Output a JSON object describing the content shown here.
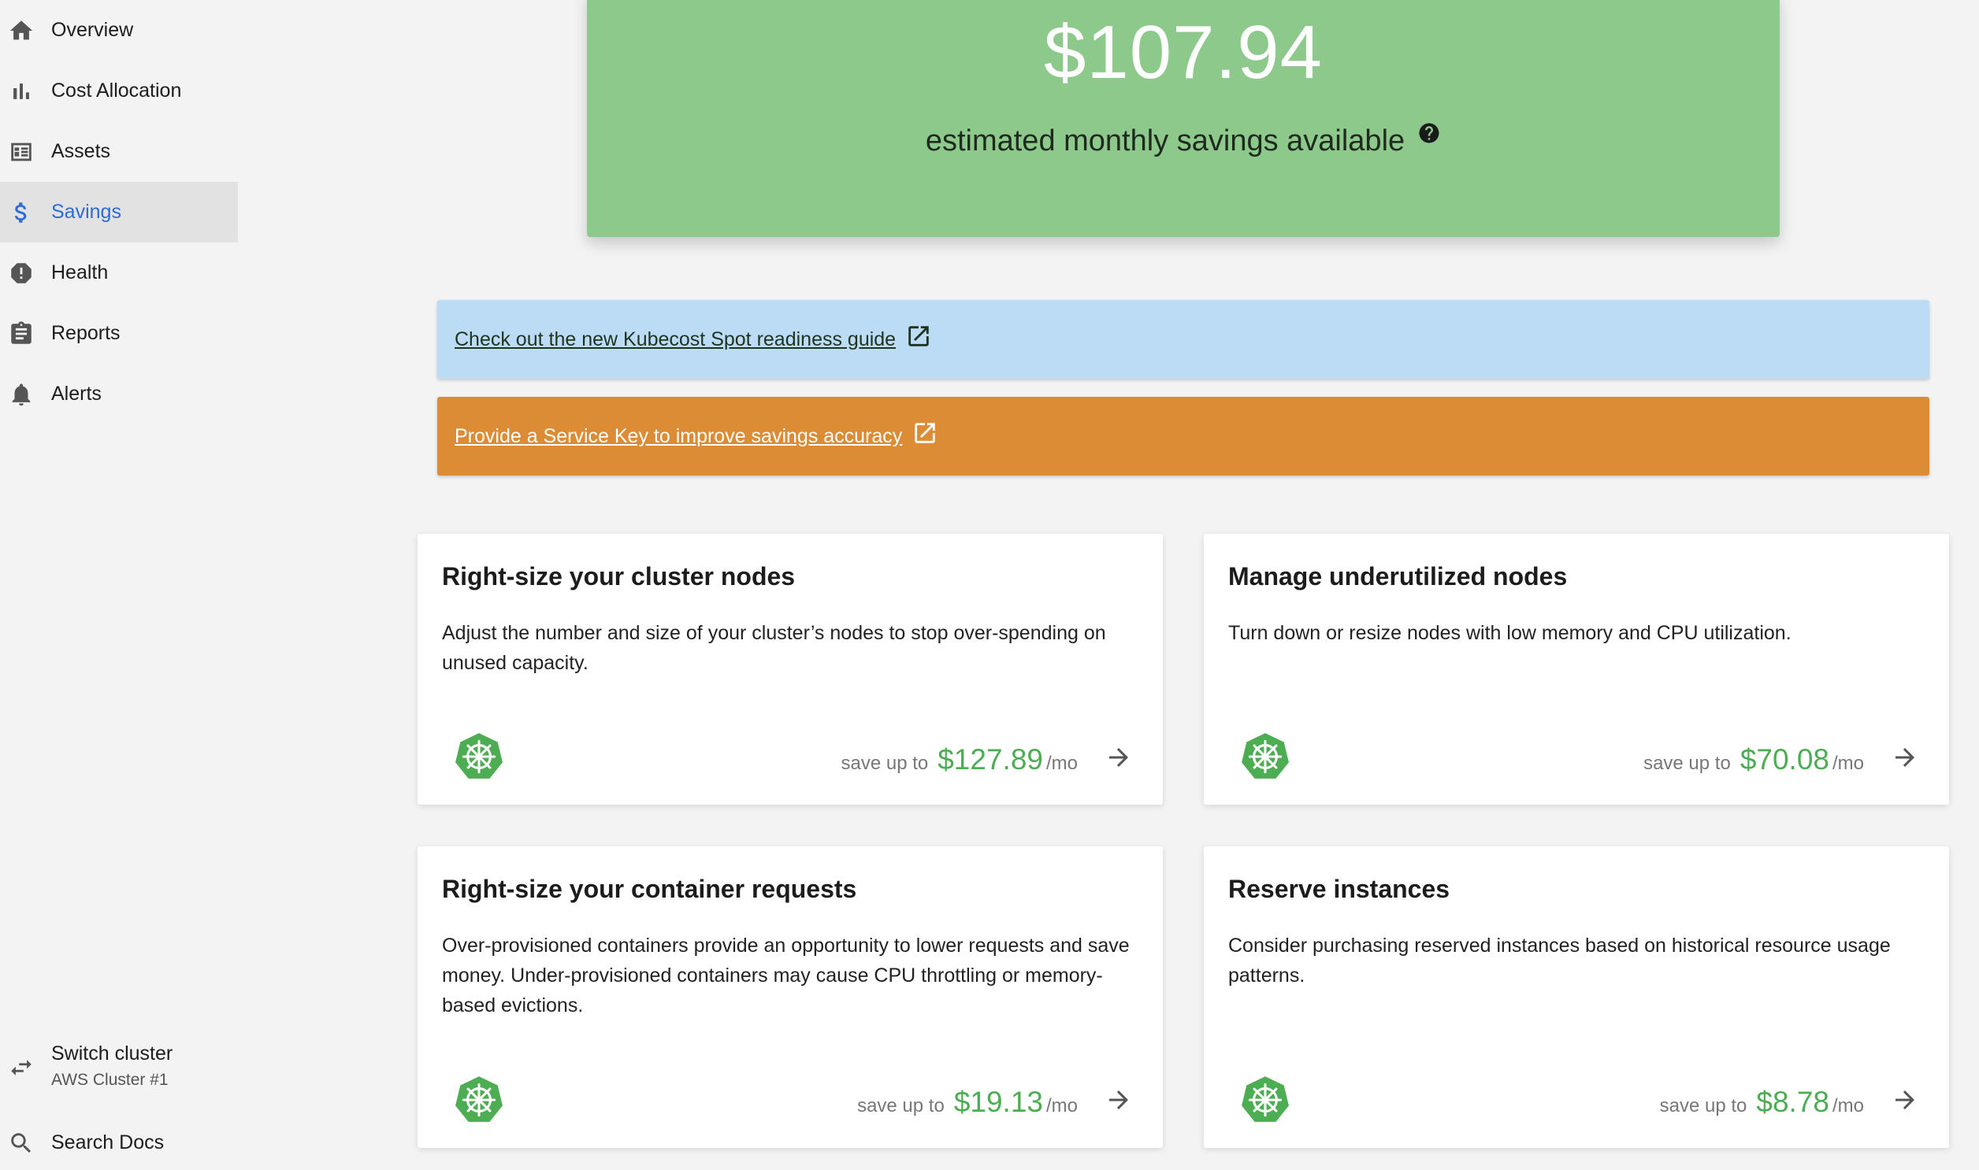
{
  "sidebar": {
    "items": [
      {
        "label": "Overview",
        "icon": "home-icon"
      },
      {
        "label": "Cost Allocation",
        "icon": "bar-chart-icon"
      },
      {
        "label": "Assets",
        "icon": "assets-icon"
      },
      {
        "label": "Savings",
        "icon": "dollar-icon",
        "active": true
      },
      {
        "label": "Health",
        "icon": "alert-octagon-icon"
      },
      {
        "label": "Reports",
        "icon": "clipboard-icon"
      },
      {
        "label": "Alerts",
        "icon": "bell-icon"
      }
    ],
    "switch_cluster": {
      "label": "Switch cluster",
      "sub": "AWS Cluster #1",
      "icon": "swap-arrows-icon"
    },
    "search_docs": {
      "label": "Search Docs",
      "icon": "search-icon"
    }
  },
  "hero": {
    "amount": "$107.94",
    "subtitle": "estimated monthly savings available",
    "color": "#8cc98a"
  },
  "banners": {
    "spot_guide": "Check out the new Kubecost Spot readiness guide",
    "service_key": "Provide a Service Key to improve savings accuracy"
  },
  "cards": [
    {
      "title": "Right-size your cluster nodes",
      "description": "Adjust the number and size of your cluster’s nodes to stop over-spending on unused capacity.",
      "save_label": "save up to",
      "amount": "$127.89",
      "unit": "/mo"
    },
    {
      "title": "Manage underutilized nodes",
      "description": "Turn down or resize nodes with low memory and CPU utilization.",
      "save_label": "save up to",
      "amount": "$70.08",
      "unit": "/mo"
    },
    {
      "title": "Right-size your container requests",
      "description": "Over-provisioned containers provide an opportunity to lower requests and save money. Under-provisioned containers may cause CPU throttling or memory-based evictions.",
      "save_label": "save up to",
      "amount": "$19.13",
      "unit": "/mo"
    },
    {
      "title": "Reserve instances",
      "description": "Consider purchasing reserved instances based on historical resource usage patterns.",
      "save_label": "save up to",
      "amount": "$8.78",
      "unit": "/mo"
    }
  ],
  "colors": {
    "accent_blue": "#2f6bd8",
    "savings_green": "#4cad52",
    "info_banner": "#bcdcf5",
    "warn_banner": "#dc8c35"
  }
}
